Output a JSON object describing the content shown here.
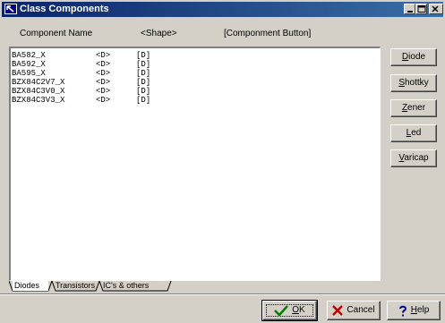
{
  "window": {
    "title": "Class Components"
  },
  "columns": {
    "name": "Component Name",
    "shape": "<Shape>",
    "button": "[Componment Button]"
  },
  "rows": [
    {
      "name": "BA582_X",
      "shape": "<D>",
      "button": "[D]"
    },
    {
      "name": "BA592_X",
      "shape": "<D>",
      "button": "[D]"
    },
    {
      "name": "BA595_X",
      "shape": "<D>",
      "button": "[D]"
    },
    {
      "name": "BZX84C2V7_X",
      "shape": "<D>",
      "button": "[D]"
    },
    {
      "name": "BZX84C3V0_X",
      "shape": "<D>",
      "button": "[D]"
    },
    {
      "name": "BZX84C3V3_X",
      "shape": "<D>",
      "button": "[D]"
    }
  ],
  "side_buttons": [
    {
      "mnemonic": "D",
      "rest": "iode"
    },
    {
      "mnemonic": "S",
      "rest": "hottky"
    },
    {
      "mnemonic": "Z",
      "rest": "ener"
    },
    {
      "mnemonic": "L",
      "rest": "ed"
    },
    {
      "mnemonic": "V",
      "rest": "aricap"
    }
  ],
  "tabs": [
    "Diodes",
    "Transistors",
    "IC's & others"
  ],
  "dialog_buttons": {
    "ok": {
      "mnemonic": "O",
      "rest": "K"
    },
    "cancel": "Cancel",
    "help": {
      "mnemonic": "H",
      "rest": "elp"
    }
  },
  "icons": {
    "ok": "checkmark-icon",
    "cancel": "x-icon",
    "help": "question-icon"
  },
  "colors": {
    "titlebar": "#0a246a",
    "ok_check": "#008000",
    "cancel_x": "#c00000",
    "help_q": "#000080"
  }
}
